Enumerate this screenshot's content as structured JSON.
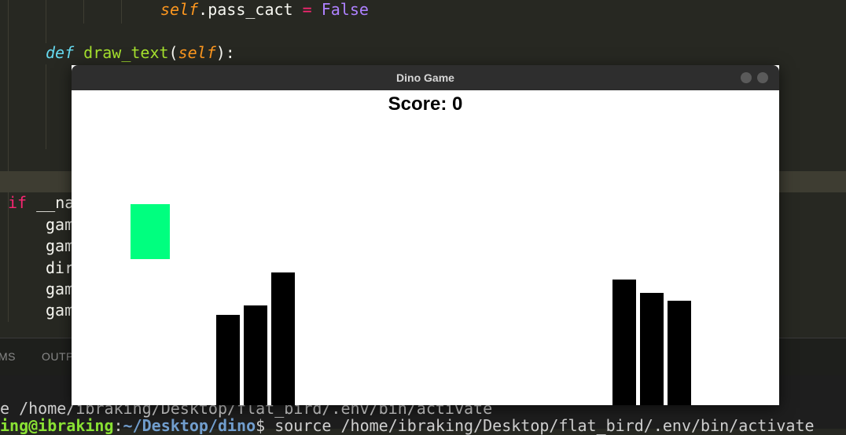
{
  "editor": {
    "lines": [
      {
        "id": "line-pass-cact"
      },
      {
        "id": "line-def-draw-text"
      }
    ],
    "code": {
      "self1": "self",
      "pass_cact": ".pass_cact ",
      "eq": "=",
      "false": " False",
      "def": "def",
      "draw_text": " draw_text",
      "paren_open": "(",
      "self2": "self",
      "paren_close": "):",
      "if": "if",
      "name_partial": " __na",
      "gam1": "gam",
      "gam2": "gam",
      "dir": "dir",
      "gam3": "gam",
      "gam4": "gam"
    }
  },
  "panel": {
    "tabs": [
      "MS",
      "OUTP"
    ]
  },
  "terminal": {
    "line1": "e /home/ibraking/Desktop/flat_bird/.env/bin/activate",
    "line2_user": "ing@ibraking",
    "line2_sep": ":",
    "line2_path": "~/Desktop/dino",
    "line2_cmd": "$ source /home/ibraking/Desktop/flat_bird/.env/bin/activate"
  },
  "window": {
    "title": "Dino Game",
    "titlebar_color": "#2e2e2e"
  },
  "game": {
    "score_label": "Score: 0",
    "score": 0,
    "dino_color": "#00ff7f",
    "cactus_color": "#000000",
    "background": "#ffffff"
  }
}
